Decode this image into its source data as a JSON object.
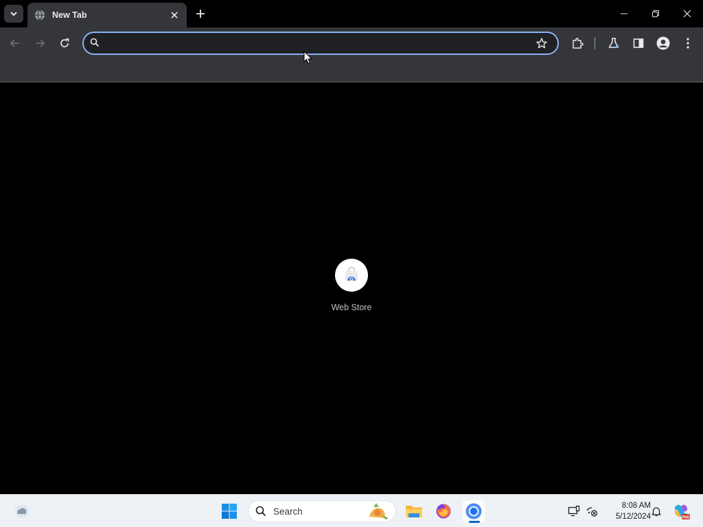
{
  "browser": {
    "tab": {
      "title": "New Tab"
    },
    "omnibox": {
      "value": "",
      "placeholder": ""
    }
  },
  "new_tab_page": {
    "shortcuts": [
      {
        "label": "Web Store",
        "icon": "web-store-icon"
      }
    ]
  },
  "taskbar": {
    "search": {
      "label": "Search"
    },
    "clock": {
      "time": "8:08 AM",
      "date": "5/12/2024"
    },
    "pinned": [
      {
        "name": "file-explorer-icon"
      },
      {
        "name": "firefox-icon"
      },
      {
        "name": "chrome-icon",
        "active": true
      }
    ]
  },
  "colors": {
    "titlebar_bg": "#000000",
    "toolbar_bg": "#35363a",
    "omnibox_bg": "#202124",
    "omnibox_focus": "#8ab4f8",
    "page_bg": "#000000",
    "taskbar_bg": "#eef1f5",
    "accent": "#0067c0"
  }
}
